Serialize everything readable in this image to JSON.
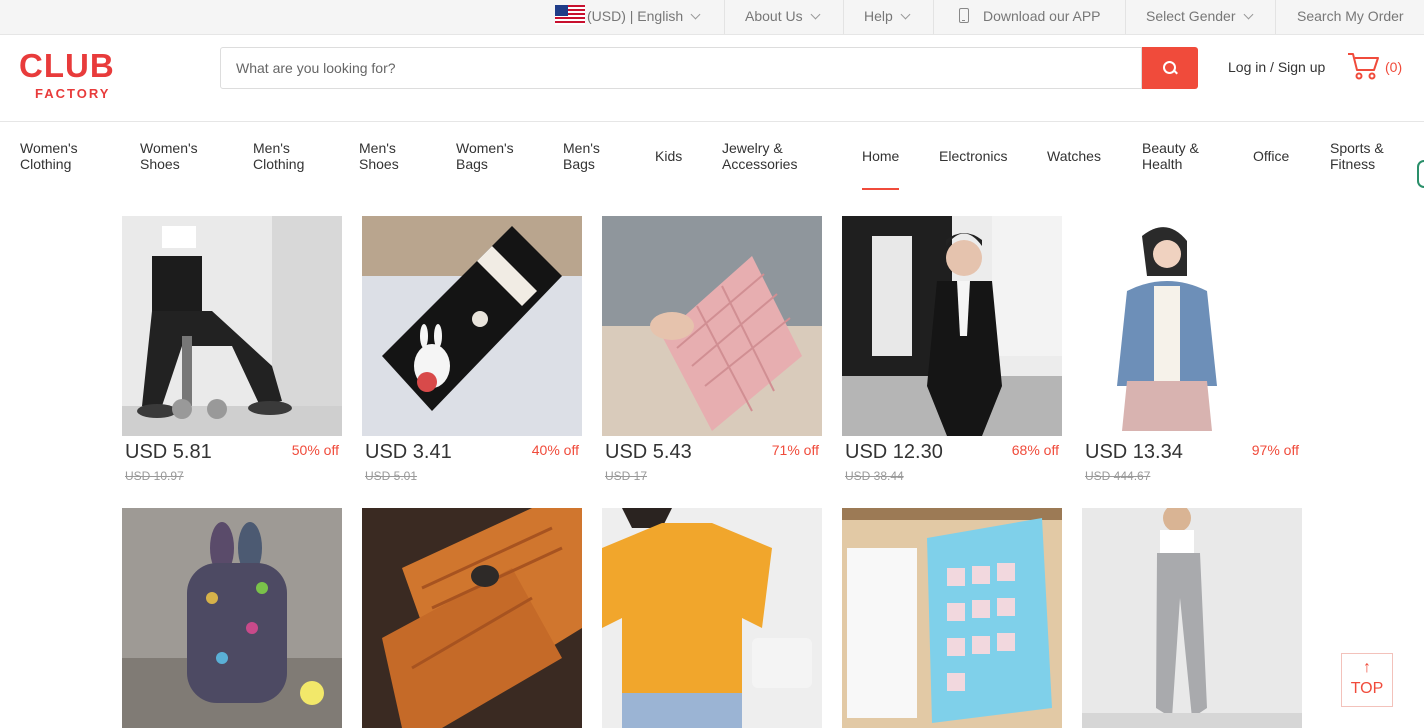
{
  "topbar": {
    "currency_lang": "(USD) | English",
    "about": "About Us",
    "help": "Help",
    "download": "Download our APP",
    "gender": "Select Gender",
    "search_order": "Search My Order"
  },
  "header": {
    "logo_top": "CLUB",
    "logo_bottom": "FACTORY",
    "search_placeholder": "What are you looking for?",
    "login": "Log in / Sign up",
    "cart_count": "(0)"
  },
  "nav": {
    "items": [
      "Women's\nClothing",
      "Women's\nShoes",
      "Men's\nClothing",
      "Men's\nShoes",
      "Women's\nBags",
      "Men's\nBags",
      "Kids",
      "Jewelry &\nAccessories",
      "Home",
      "Electronics",
      "Watches",
      "Beauty &\nHealth",
      "Office",
      "Sports &\nFitness"
    ],
    "active": "Home"
  },
  "products": [
    {
      "price": "USD 5.81",
      "discount": "50% off",
      "old": "USD 10.97",
      "icon": "leggings-photo"
    },
    {
      "price": "USD 3.41",
      "discount": "40% off",
      "old": "USD 5.01",
      "icon": "bunny-wallet-photo"
    },
    {
      "price": "USD 5.43",
      "discount": "71% off",
      "old": "USD 17",
      "icon": "pink-wallet-photo"
    },
    {
      "price": "USD 12.30",
      "discount": "68% off",
      "old": "USD 38.44",
      "icon": "mens-blazer-photo"
    },
    {
      "price": "USD 13.34",
      "discount": "97% off",
      "old": "USD 444.67",
      "icon": "denim-jacket-photo"
    },
    {
      "icon": "sequin-backpack-photo"
    },
    {
      "icon": "wood-phone-case-photo"
    },
    {
      "icon": "yellow-tshirt-photo"
    },
    {
      "icon": "hanging-organizer-photo"
    },
    {
      "icon": "grey-trousers-photo"
    }
  ],
  "top_button": {
    "arrow": "↑",
    "label": "TOP"
  },
  "colors": {
    "accent": "#f04b3b",
    "logo": "#e83b3b"
  }
}
